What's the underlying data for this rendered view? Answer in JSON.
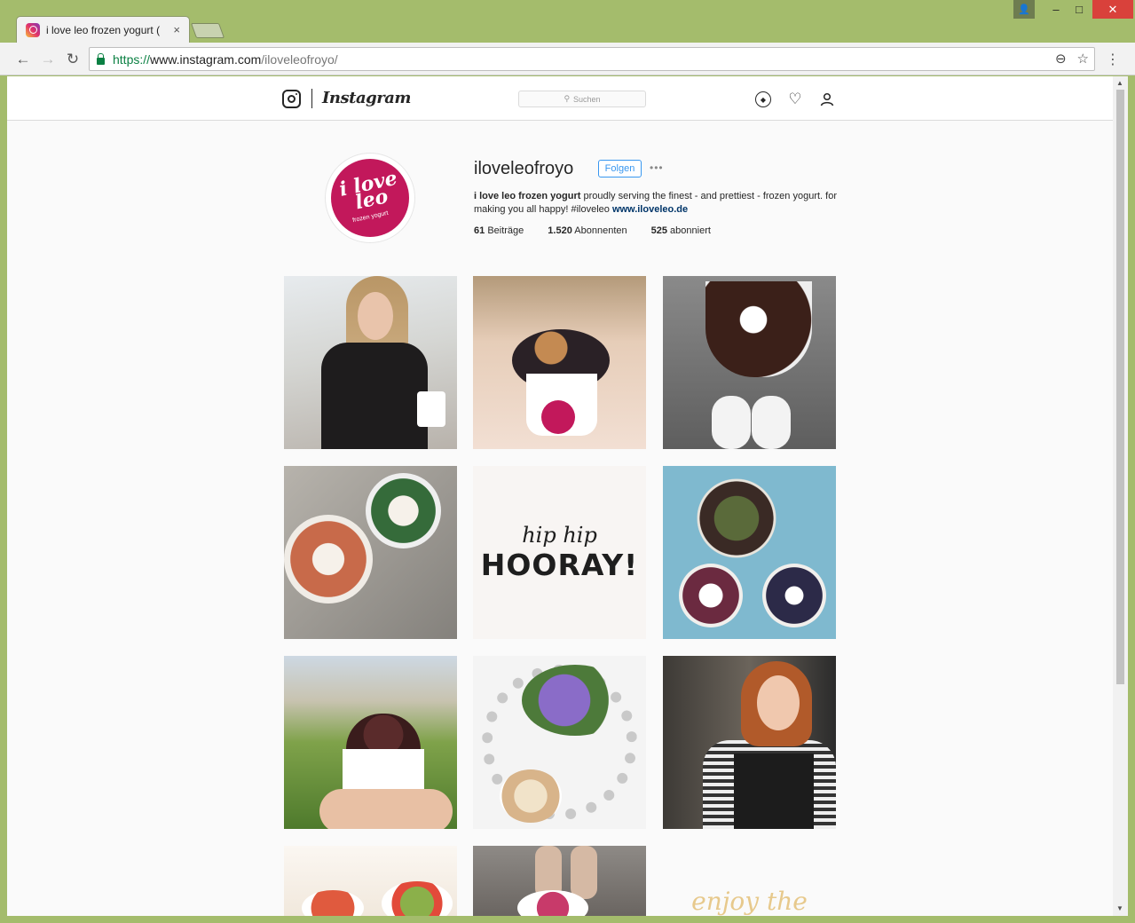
{
  "browser": {
    "tab_title": "i love leo frozen yogurt (",
    "tab_close": "×",
    "window_buttons": {
      "min": "–",
      "max": "□",
      "close": "✕"
    },
    "url": {
      "scheme": "https://",
      "host": "www.instagram.com",
      "path": "/iloveleofroyo/"
    }
  },
  "instagram": {
    "header": {
      "wordmark": "Instagram",
      "search_placeholder": "Suchen"
    },
    "profile": {
      "username": "iloveleofroyo",
      "follow_label": "Folgen",
      "more_label": "•••",
      "bio_name": "i love leo frozen yogurt",
      "bio_text": " proudly serving the finest - and prettiest - frozen yogurt. for making you all happy! #iloveleo ",
      "bio_link": "www.iloveleo.de",
      "stats": [
        {
          "value": "61",
          "label": "Beiträge"
        },
        {
          "value": "1.520",
          "label": "Abonnenten"
        },
        {
          "value": "525",
          "label": "abonniert"
        }
      ],
      "avatar": {
        "text_line1": "i love",
        "text_line2": "leo",
        "subtext": "frozen yogurt",
        "color": "#c2185b"
      }
    },
    "posts": {
      "hip_hip": "hip hip",
      "hooray": "HOORAY!",
      "enjoy": "enjoy the"
    }
  },
  "colors": {
    "window_frame": "#a4bc6c",
    "follow_blue": "#3897f0",
    "avatar_magenta": "#c2185b",
    "secure_green": "#0b8043"
  }
}
